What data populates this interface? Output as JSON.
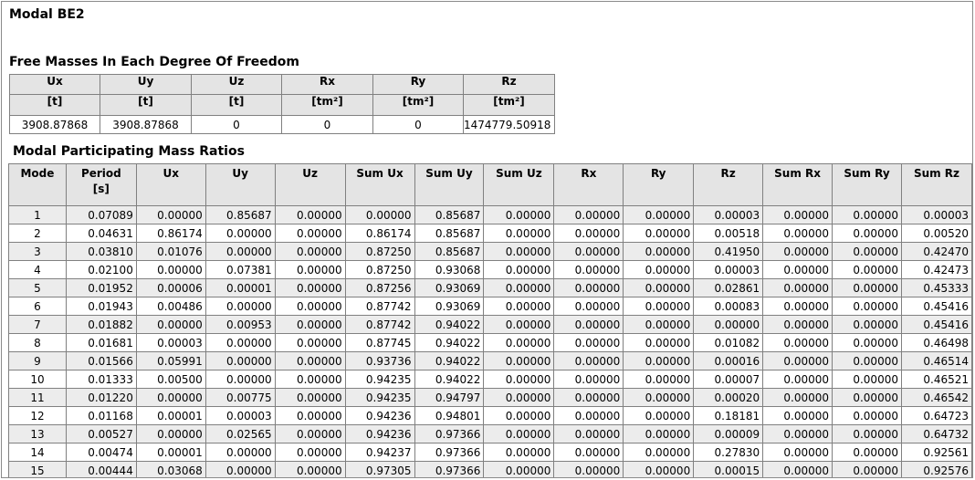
{
  "report": {
    "title": "Modal BE2"
  },
  "free_masses": {
    "title": "Free Masses In Each Degree Of Freedom",
    "headers": [
      {
        "label": "Ux",
        "unit": "[t]"
      },
      {
        "label": "Uy",
        "unit": "[t]"
      },
      {
        "label": "Uz",
        "unit": "[t]"
      },
      {
        "label": "Rx",
        "unit": "[tm²]"
      },
      {
        "label": "Ry",
        "unit": "[tm²]"
      },
      {
        "label": "Rz",
        "unit": "[tm²]"
      }
    ],
    "values": [
      "3908.87868",
      "3908.87868",
      "0",
      "0",
      "0",
      "1474779.50918"
    ]
  },
  "modal_ratios": {
    "title": "Modal Participating Mass Ratios",
    "headers": [
      {
        "label": "Mode",
        "unit": ""
      },
      {
        "label": "Period",
        "unit": "[s]"
      },
      {
        "label": "Ux",
        "unit": ""
      },
      {
        "label": "Uy",
        "unit": ""
      },
      {
        "label": "Uz",
        "unit": ""
      },
      {
        "label": "Sum Ux",
        "unit": ""
      },
      {
        "label": "Sum Uy",
        "unit": ""
      },
      {
        "label": "Sum Uz",
        "unit": ""
      },
      {
        "label": "Rx",
        "unit": ""
      },
      {
        "label": "Ry",
        "unit": ""
      },
      {
        "label": "Rz",
        "unit": ""
      },
      {
        "label": "Sum Rx",
        "unit": ""
      },
      {
        "label": "Sum Ry",
        "unit": ""
      },
      {
        "label": "Sum Rz",
        "unit": ""
      }
    ],
    "rows": [
      [
        "1",
        "0.07089",
        "0.00000",
        "0.85687",
        "0.00000",
        "0.00000",
        "0.85687",
        "0.00000",
        "0.00000",
        "0.00000",
        "0.00003",
        "0.00000",
        "0.00000",
        "0.00003"
      ],
      [
        "2",
        "0.04631",
        "0.86174",
        "0.00000",
        "0.00000",
        "0.86174",
        "0.85687",
        "0.00000",
        "0.00000",
        "0.00000",
        "0.00518",
        "0.00000",
        "0.00000",
        "0.00520"
      ],
      [
        "3",
        "0.03810",
        "0.01076",
        "0.00000",
        "0.00000",
        "0.87250",
        "0.85687",
        "0.00000",
        "0.00000",
        "0.00000",
        "0.41950",
        "0.00000",
        "0.00000",
        "0.42470"
      ],
      [
        "4",
        "0.02100",
        "0.00000",
        "0.07381",
        "0.00000",
        "0.87250",
        "0.93068",
        "0.00000",
        "0.00000",
        "0.00000",
        "0.00003",
        "0.00000",
        "0.00000",
        "0.42473"
      ],
      [
        "5",
        "0.01952",
        "0.00006",
        "0.00001",
        "0.00000",
        "0.87256",
        "0.93069",
        "0.00000",
        "0.00000",
        "0.00000",
        "0.02861",
        "0.00000",
        "0.00000",
        "0.45333"
      ],
      [
        "6",
        "0.01943",
        "0.00486",
        "0.00000",
        "0.00000",
        "0.87742",
        "0.93069",
        "0.00000",
        "0.00000",
        "0.00000",
        "0.00083",
        "0.00000",
        "0.00000",
        "0.45416"
      ],
      [
        "7",
        "0.01882",
        "0.00000",
        "0.00953",
        "0.00000",
        "0.87742",
        "0.94022",
        "0.00000",
        "0.00000",
        "0.00000",
        "0.00000",
        "0.00000",
        "0.00000",
        "0.45416"
      ],
      [
        "8",
        "0.01681",
        "0.00003",
        "0.00000",
        "0.00000",
        "0.87745",
        "0.94022",
        "0.00000",
        "0.00000",
        "0.00000",
        "0.01082",
        "0.00000",
        "0.00000",
        "0.46498"
      ],
      [
        "9",
        "0.01566",
        "0.05991",
        "0.00000",
        "0.00000",
        "0.93736",
        "0.94022",
        "0.00000",
        "0.00000",
        "0.00000",
        "0.00016",
        "0.00000",
        "0.00000",
        "0.46514"
      ],
      [
        "10",
        "0.01333",
        "0.00500",
        "0.00000",
        "0.00000",
        "0.94235",
        "0.94022",
        "0.00000",
        "0.00000",
        "0.00000",
        "0.00007",
        "0.00000",
        "0.00000",
        "0.46521"
      ],
      [
        "11",
        "0.01220",
        "0.00000",
        "0.00775",
        "0.00000",
        "0.94235",
        "0.94797",
        "0.00000",
        "0.00000",
        "0.00000",
        "0.00020",
        "0.00000",
        "0.00000",
        "0.46542"
      ],
      [
        "12",
        "0.01168",
        "0.00001",
        "0.00003",
        "0.00000",
        "0.94236",
        "0.94801",
        "0.00000",
        "0.00000",
        "0.00000",
        "0.18181",
        "0.00000",
        "0.00000",
        "0.64723"
      ],
      [
        "13",
        "0.00527",
        "0.00000",
        "0.02565",
        "0.00000",
        "0.94236",
        "0.97366",
        "0.00000",
        "0.00000",
        "0.00000",
        "0.00009",
        "0.00000",
        "0.00000",
        "0.64732"
      ],
      [
        "14",
        "0.00474",
        "0.00001",
        "0.00000",
        "0.00000",
        "0.94237",
        "0.97366",
        "0.00000",
        "0.00000",
        "0.00000",
        "0.27830",
        "0.00000",
        "0.00000",
        "0.92561"
      ],
      [
        "15",
        "0.00444",
        "0.03068",
        "0.00000",
        "0.00000",
        "0.97305",
        "0.97366",
        "0.00000",
        "0.00000",
        "0.00000",
        "0.00015",
        "0.00000",
        "0.00000",
        "0.92576"
      ]
    ]
  }
}
